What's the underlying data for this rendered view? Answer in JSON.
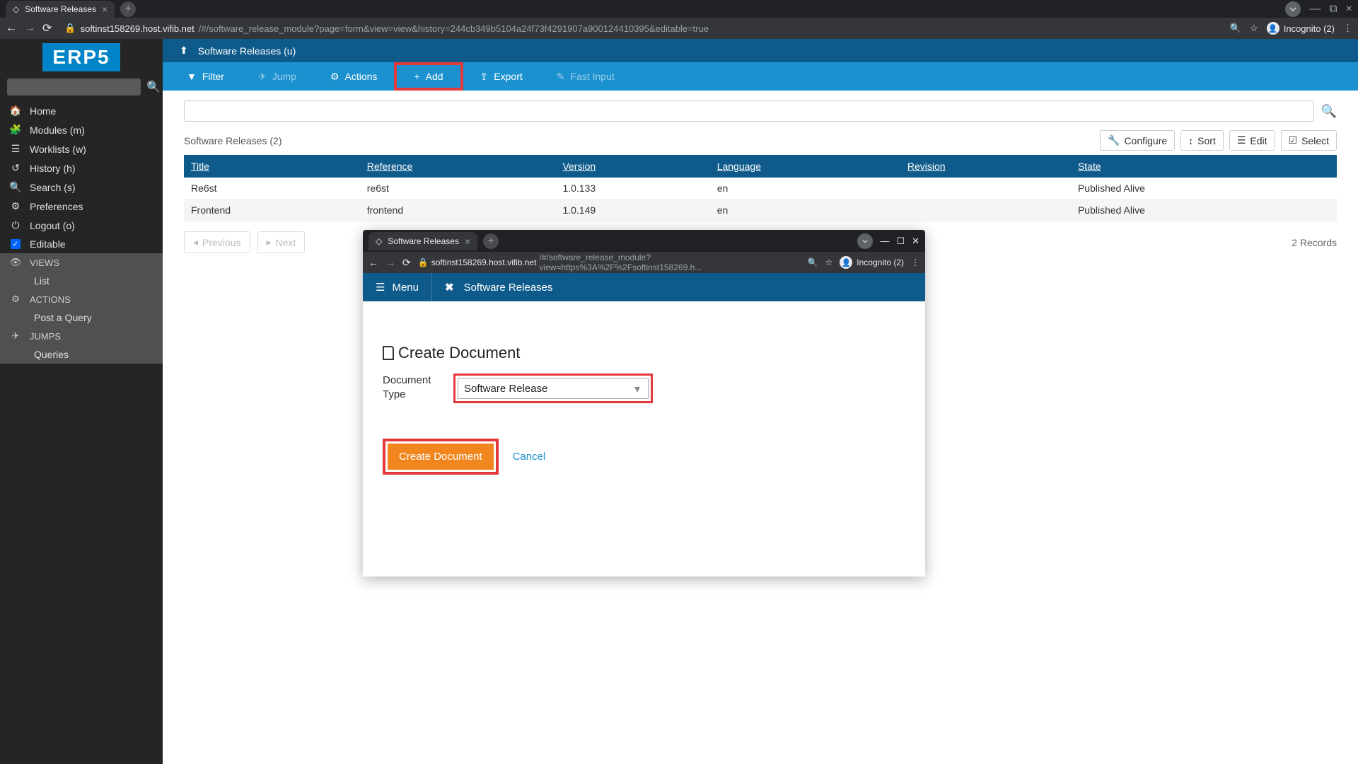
{
  "browser": {
    "tab_title": "Software Releases",
    "url_host": "softinst158269.host.vifib.net",
    "url_path": "/#/software_release_module?page=form&view=view&history=244cb349b5104a24f73f4291907a900124410395&editable=true",
    "incognito_label": "Incognito (2)"
  },
  "sidebar": {
    "logo": "ERP5",
    "items": [
      {
        "label": "Home"
      },
      {
        "label": "Modules (m)"
      },
      {
        "label": "Worklists (w)"
      },
      {
        "label": "History (h)"
      },
      {
        "label": "Search (s)"
      },
      {
        "label": "Preferences"
      },
      {
        "label": "Logout (o)"
      },
      {
        "label": "Editable"
      }
    ],
    "sections": {
      "views": {
        "header": "VIEWS",
        "items": [
          "List"
        ]
      },
      "actions": {
        "header": "ACTIONS",
        "items": [
          "Post a Query"
        ]
      },
      "jumps": {
        "header": "JUMPS",
        "items": [
          "Queries"
        ]
      }
    }
  },
  "breadcrumb": "Software Releases (u)",
  "toolbar": {
    "filter": "Filter",
    "jump": "Jump",
    "actions": "Actions",
    "add": "Add",
    "export": "Export",
    "fast_input": "Fast Input"
  },
  "table": {
    "title": "Software Releases (2)",
    "actions": {
      "configure": "Configure",
      "sort": "Sort",
      "edit": "Edit",
      "select": "Select"
    },
    "columns": [
      "Title",
      "Reference",
      "Version",
      "Language",
      "Revision",
      "State"
    ],
    "rows": [
      {
        "title": "Re6st",
        "reference": "re6st",
        "version": "1.0.133",
        "language": "en",
        "revision": "",
        "state": "Published Alive"
      },
      {
        "title": "Frontend",
        "reference": "frontend",
        "version": "1.0.149",
        "language": "en",
        "revision": "",
        "state": "Published Alive"
      }
    ],
    "pagination": {
      "previous": "Previous",
      "next": "Next",
      "records": "2 Records"
    }
  },
  "popup": {
    "tab_title": "Software Releases",
    "url_host": "softinst158269.host.vifib.net",
    "url_path": "/#/software_release_module?view=https%3A%2F%2Fsoftinst158269.h...",
    "incognito_label": "Incognito (2)",
    "menu_label": "Menu",
    "title": "Software Releases",
    "heading": "Create Document",
    "form_label": "Document Type",
    "select_value": "Software Release",
    "create_btn": "Create Document",
    "cancel": "Cancel"
  }
}
